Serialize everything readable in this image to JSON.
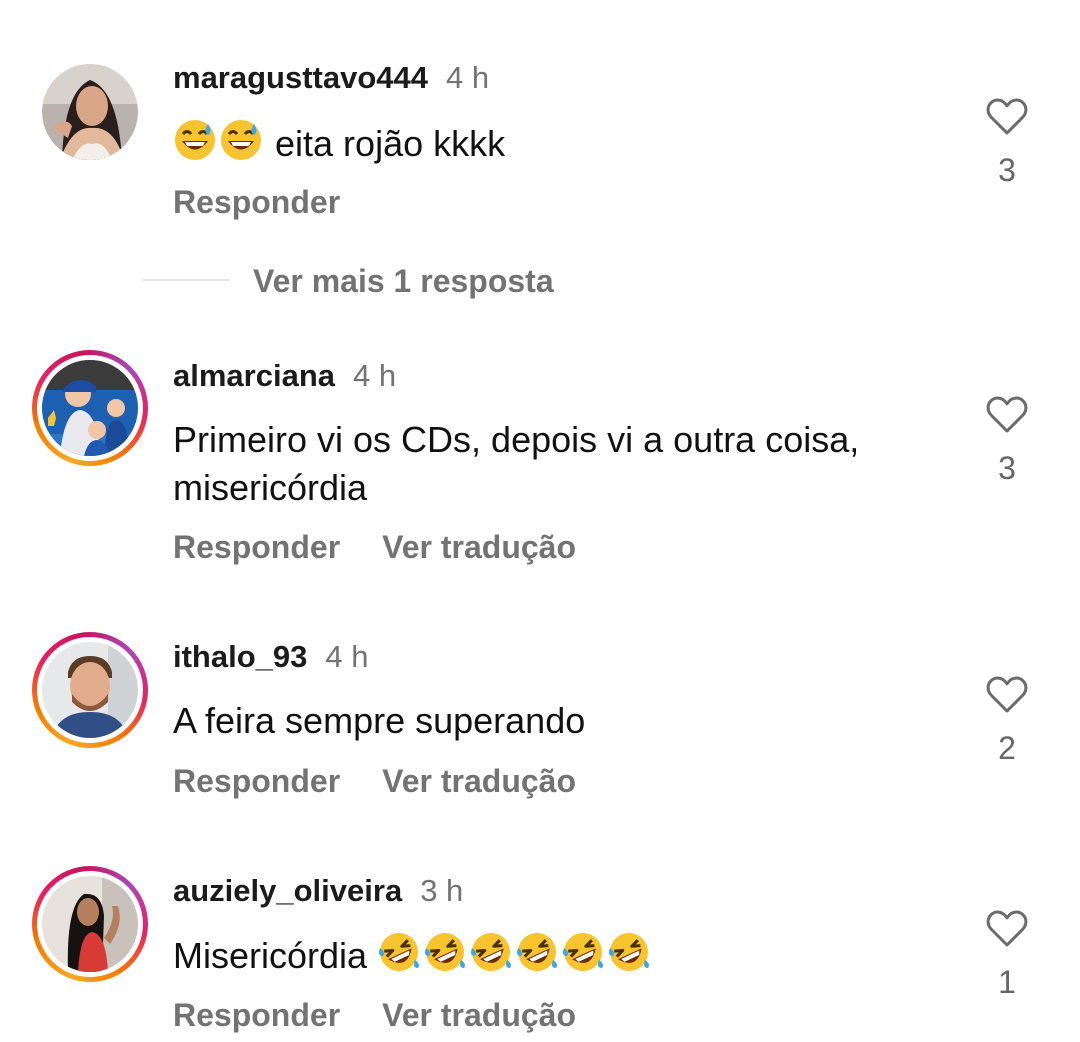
{
  "comments": [
    {
      "username": "maragusttavo444",
      "time": "4 h",
      "text_prefix": "",
      "text": "eita rojão kkkk",
      "reply_label": "Responder",
      "translate_label": "",
      "like_count": "3",
      "avatar_icon": "profile-photo",
      "emoji_icon": "grinning-sweat-emoji",
      "emoji_count": 2
    },
    {
      "username": "almarciana",
      "time": "4 h",
      "text": "Primeiro  vi os CDs,  depois vi a outra coisa, misericórdia",
      "reply_label": "Responder",
      "translate_label": "Ver tradução",
      "like_count": "3",
      "avatar_icon": "profile-photo"
    },
    {
      "username": "ithalo_93",
      "time": "4 h",
      "text": "A feira sempre superando",
      "reply_label": "Responder",
      "translate_label": "Ver tradução",
      "like_count": "2",
      "avatar_icon": "profile-photo"
    },
    {
      "username": "auziely_oliveira",
      "time": "3 h",
      "text": "Misericórdia",
      "reply_label": "Responder",
      "translate_label": "Ver tradução",
      "like_count": "1",
      "avatar_icon": "profile-photo",
      "emoji_icon": "rolling-on-floor-laughing-emoji",
      "emoji_count": 6
    }
  ],
  "more_replies": {
    "label": "Ver mais 1 resposta"
  },
  "icons": {
    "like": "heart-outline-icon"
  },
  "colors": {
    "username": "#1b1b1b",
    "muted": "#737373",
    "story_ring_start": "#f9a825",
    "story_ring_end": "#c2185b",
    "emoji_face": "#f7c32e",
    "emoji_tears": "#3aa8e6"
  }
}
